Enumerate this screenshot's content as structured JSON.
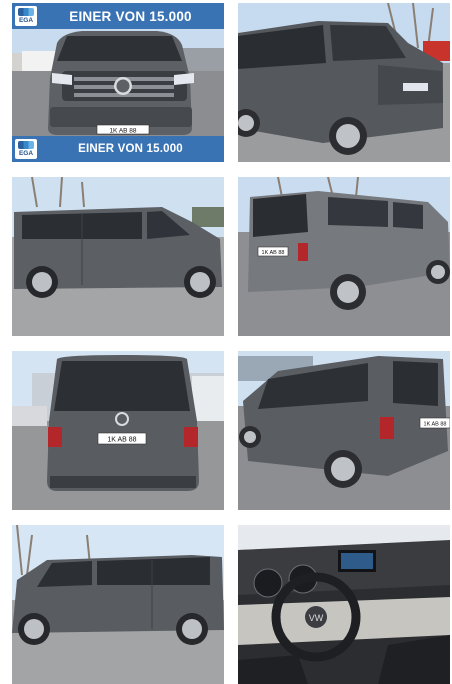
{
  "gallery": {
    "banner_top_text": "EINER VON 15.000",
    "banner_bottom_text": "EINER VON 15.000",
    "logo_text": "EGA",
    "plates": {
      "front": "1K AB 88",
      "rear": "1K AB 88",
      "rear_side": "1K AB 88",
      "rear_left": "1K AB 88",
      "rear_right": "1K AB 88"
    },
    "colors": {
      "banner": "#3a73b4",
      "van": "#5b5e63",
      "sky": "#bfd6ec"
    },
    "images": [
      "van-front-image",
      "van-front-left-image",
      "van-left-side-image",
      "van-rear-left-image",
      "van-rear-image",
      "van-rear-right-image",
      "van-right-side-image",
      "van-interior-image"
    ]
  }
}
